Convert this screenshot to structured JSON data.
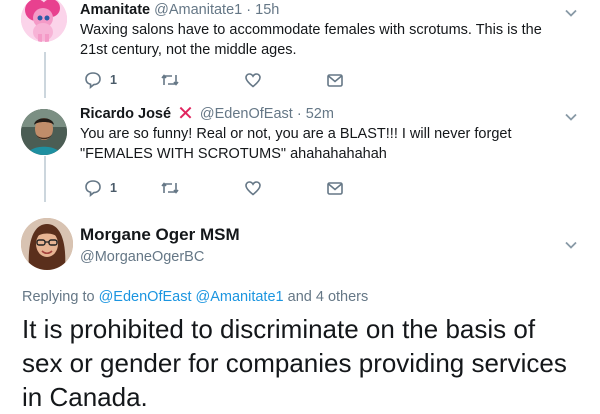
{
  "tweets": [
    {
      "name": "Amanitate",
      "handle": "@Amanitate1",
      "time": "15h",
      "text": "Waxing salons have to accommodate females with scrotums. This is the 21st century, not the middle ages.",
      "reply_count": "1",
      "avatar_icon": "pony-avatar"
    },
    {
      "name": "Ricardo José",
      "badge": "❌",
      "handle": "@EdenOfEast",
      "time": "52m",
      "text": "You are so funny! Real or not, you are a BLAST!!! I will never forget \"FEMALES WITH SCROTUMS\" ahahahahahah",
      "reply_count": "1",
      "avatar_icon": "person-avatar"
    }
  ],
  "main_tweet": {
    "name": "Morgane Oger MSM",
    "handle": "@MorganeOgerBC",
    "replying_prefix": "Replying to",
    "reply_targets": [
      "@EdenOfEast",
      "@Amanitate1"
    ],
    "replying_suffix": "and 4 others",
    "text": "It is prohibited to discriminate on the basis of sex or gender for companies providing services in Canada."
  },
  "colors": {
    "secondary_text": "#657786",
    "link": "#1b95e0",
    "thread_line": "#ccd6dd",
    "x_mark": "#e0245e"
  }
}
